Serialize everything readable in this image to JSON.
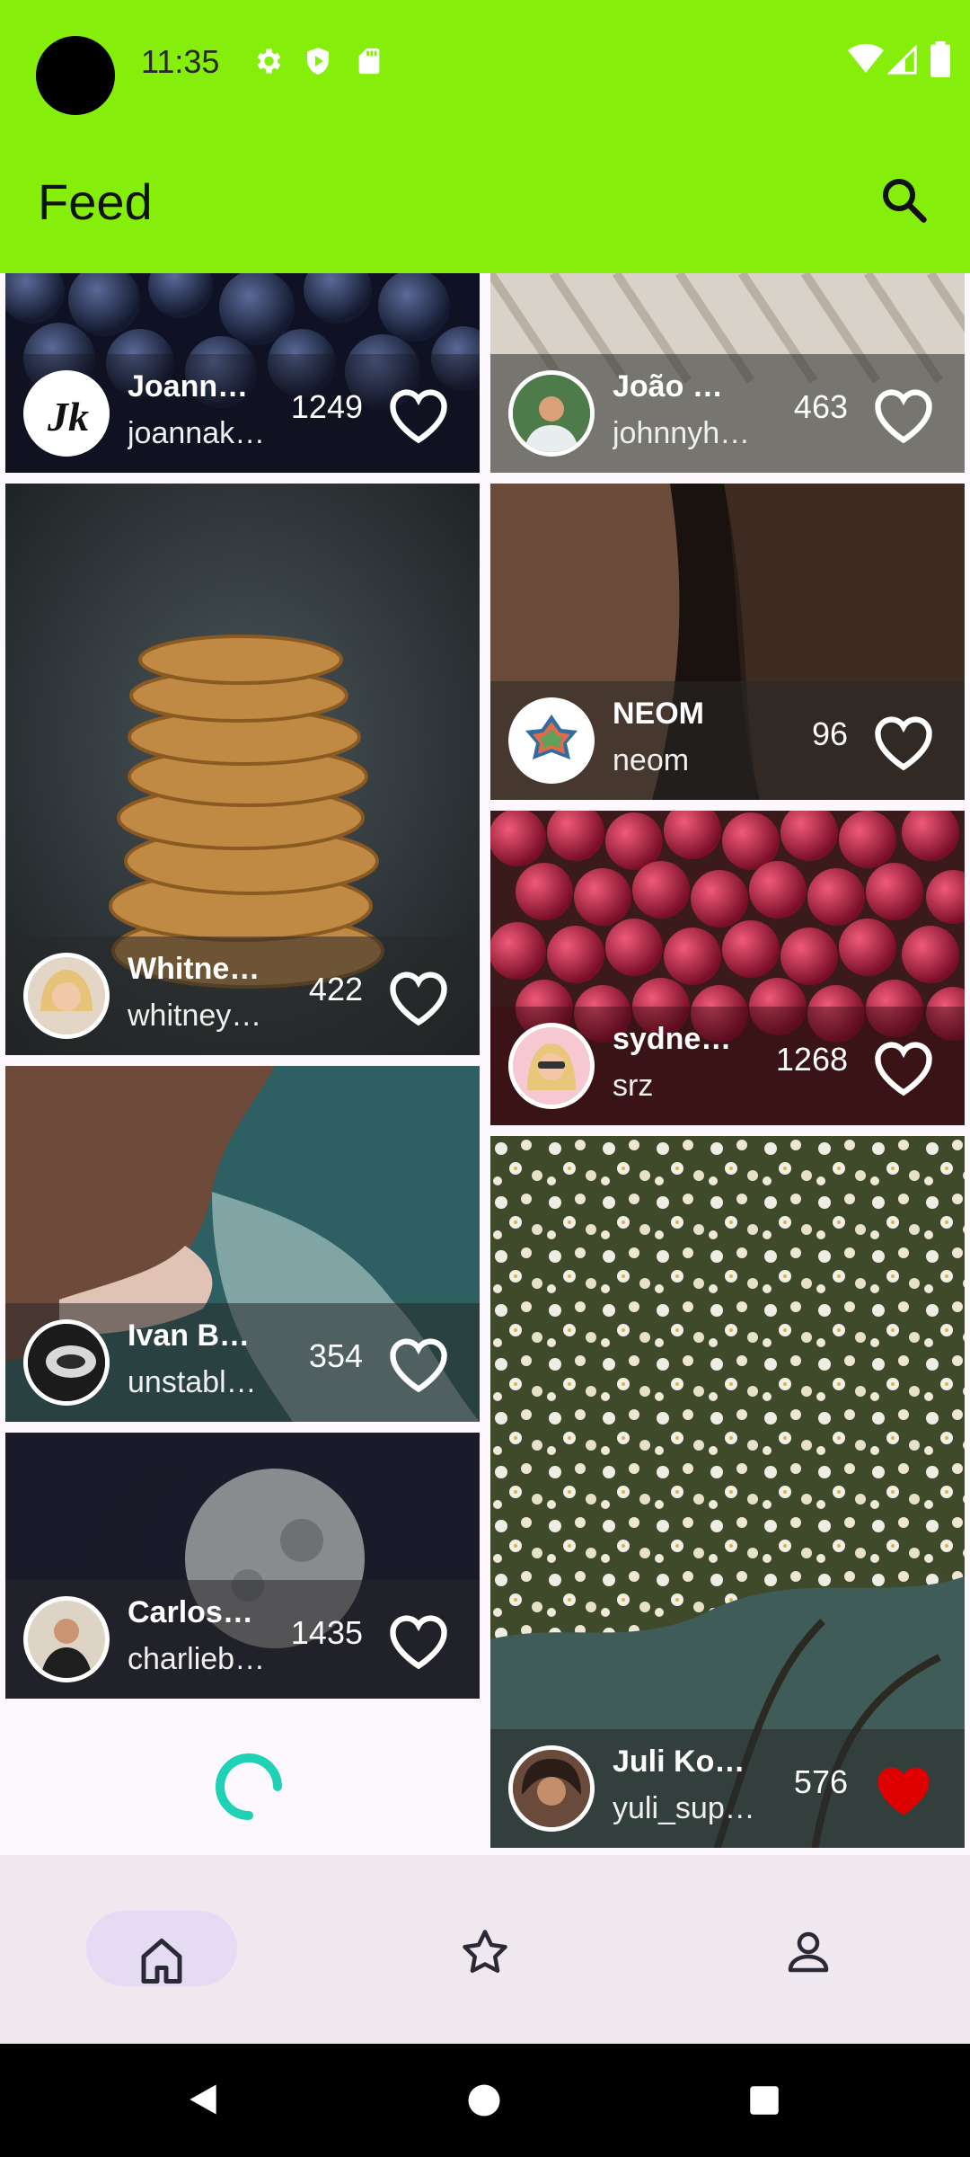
{
  "status_bar": {
    "time": "11:35",
    "left_icons": [
      "gear-icon",
      "shield-icon",
      "sd-card-icon"
    ],
    "right_icons": [
      "wifi-icon",
      "signal-icon",
      "battery-icon"
    ]
  },
  "app_bar": {
    "title": "Feed",
    "search_icon": "search-icon"
  },
  "feed": {
    "posts": [
      {
        "name": "Joann…",
        "handle": "joannak…",
        "likes": "1249",
        "liked": false
      },
      {
        "name": "João M…",
        "handle": "johnnyha…",
        "likes": "463",
        "liked": false
      },
      {
        "name": "Whitne…",
        "handle": "whitney_…",
        "likes": "422",
        "liked": false
      },
      {
        "name": "NEOM",
        "handle": "neom",
        "likes": "96",
        "liked": false
      },
      {
        "name": "sydne…",
        "handle": "srz",
        "likes": "1268",
        "liked": false
      },
      {
        "name": "Ivan Ba…",
        "handle": "unstable_…",
        "likes": "354",
        "liked": false
      },
      {
        "name": "Carlos…",
        "handle": "charlieb…",
        "likes": "1435",
        "liked": false
      },
      {
        "name": "Juli Kos…",
        "handle": "yuli_supe…",
        "likes": "576",
        "liked": true
      }
    ]
  },
  "bottom_nav": {
    "items": [
      {
        "icon": "home-icon",
        "selected": true
      },
      {
        "icon": "star-icon",
        "selected": false
      },
      {
        "icon": "person-icon",
        "selected": false
      }
    ]
  },
  "colors": {
    "app_bar": "#86ee0b",
    "spinner": "#1fd1b5",
    "liked_heart": "#e00000",
    "nav_pill": "#e5dcf4"
  }
}
